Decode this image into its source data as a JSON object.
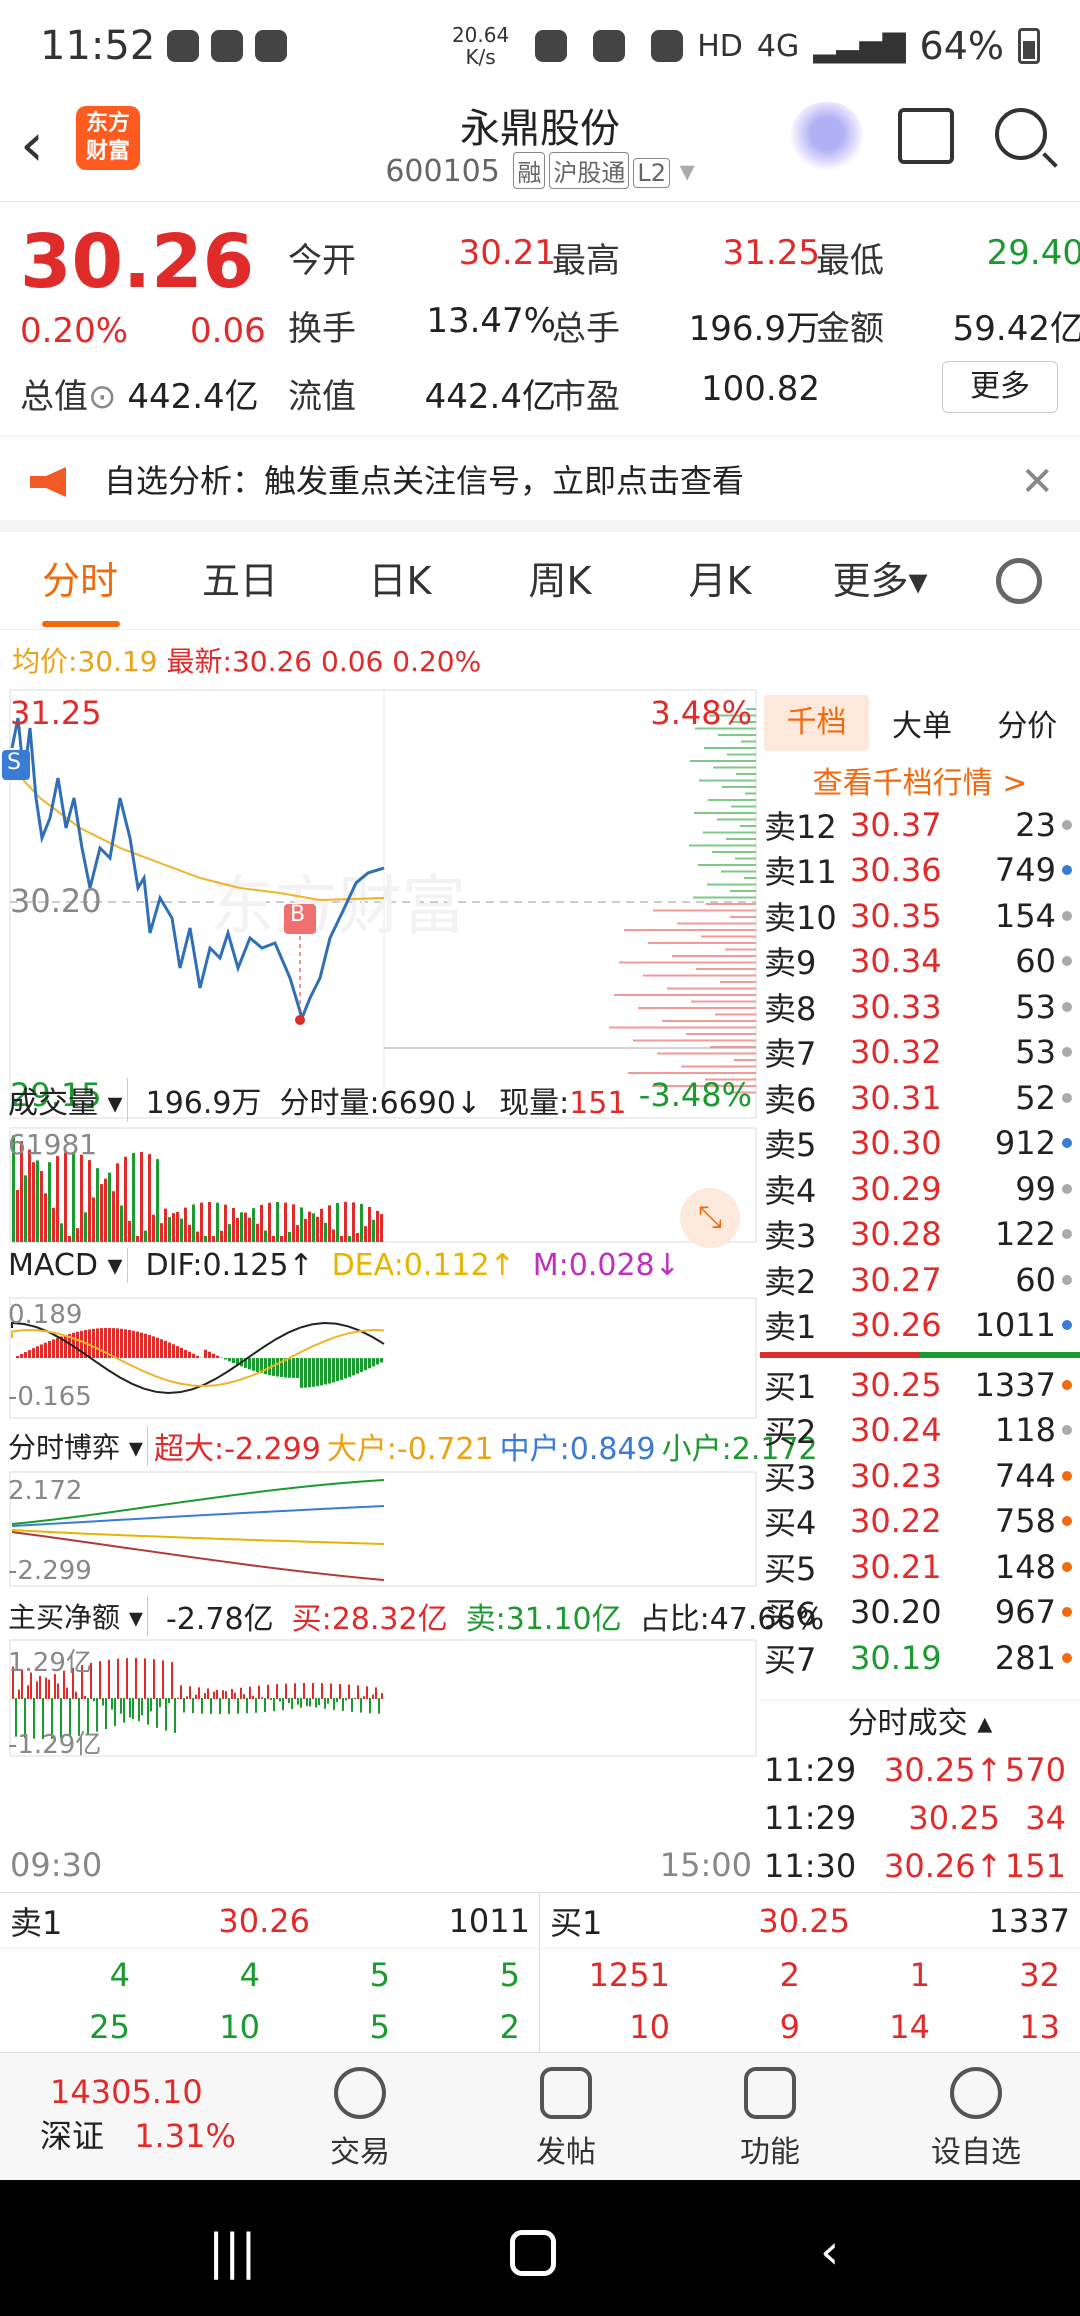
{
  "status": {
    "time": "11:52",
    "speed_value": "20.64",
    "speed_unit": "K/s",
    "network": "4G",
    "hd": "HD",
    "battery": "64%"
  },
  "header": {
    "logo_text": "东方财富",
    "title": "永鼎股份",
    "code": "600105",
    "tags": [
      "融",
      "沪股通",
      "L2"
    ]
  },
  "quote": {
    "price": "30.26",
    "pct": "0.20%",
    "change": "0.06",
    "fields": [
      {
        "label": "今开",
        "value": "30.21",
        "color": "#e02b2b"
      },
      {
        "label": "最高",
        "value": "31.25",
        "color": "#e02b2b"
      },
      {
        "label": "最低",
        "value": "29.40",
        "color": "#1b9a2f"
      },
      {
        "label": "换手",
        "value": "13.47%",
        "color": "#222"
      },
      {
        "label": "总手",
        "value": "196.9万",
        "color": "#222"
      },
      {
        "label": "金额",
        "value": "59.42亿",
        "color": "#222"
      },
      {
        "label": "流值",
        "value": "442.4亿",
        "color": "#222"
      },
      {
        "label": "市盈",
        "value": "100.82",
        "color": "#222"
      }
    ],
    "zongzhi_label": "总值",
    "zongzhi_value": "442.4亿",
    "more_label": "更多"
  },
  "alert": {
    "text": "自选分析：触发重点关注信号，立即点击查看"
  },
  "tabs": [
    "分时",
    "五日",
    "日K",
    "周K",
    "月K",
    "更多▾"
  ],
  "avg_row": {
    "avg_label": "均价:",
    "avg": "30.19",
    "new_label": "最新:",
    "new": "30.26",
    "chg": "0.06",
    "pct": "0.20%"
  },
  "intraday": {
    "high": "31.25",
    "low": "29.15",
    "mid": "30.20",
    "pct_up": "3.48%",
    "pct_down": "-3.48%",
    "watermark": "东方财富",
    "marker": "B",
    "badge": "S"
  },
  "volume_row": {
    "label": "成交量",
    "total": "196.9万",
    "fs_label": "分时量:",
    "fs": "6690↓",
    "now_label": "现量:",
    "now": "151",
    "max": "61981"
  },
  "macd_row": {
    "label": "MACD",
    "dif": "DIF:0.125↑",
    "dea": "DEA:0.112↑",
    "m": "M:0.028↓",
    "top": "0.189",
    "bottom": "-0.165"
  },
  "game_row": {
    "label": "分时博弈",
    "cd": "超大:-2.299",
    "d": "大户:-0.721",
    "z": "中户:0.849",
    "x": "小户:2.172",
    "top": "2.172",
    "bottom": "-2.299"
  },
  "flow_row": {
    "label": "主买净额",
    "net": "-2.78亿",
    "buy": "买:28.32亿",
    "sell": "卖:31.10亿",
    "ratio": "占比:47.66%",
    "top": "1.29亿",
    "bottom": "-1.29亿"
  },
  "time_axis": {
    "start": "09:30",
    "end": "15:00"
  },
  "book": {
    "tabs": [
      "千档",
      "大单",
      "分价"
    ],
    "link": "查看千档行情 >",
    "asks": [
      {
        "n": "卖12",
        "p": "30.37",
        "v": "23",
        "w": 0.02,
        "c": "#aaa"
      },
      {
        "n": "卖11",
        "p": "30.36",
        "v": "749",
        "w": 0.4,
        "c": "#3a7bd5"
      },
      {
        "n": "卖10",
        "p": "30.35",
        "v": "154",
        "w": 0.08,
        "c": "#aaa"
      },
      {
        "n": "卖9",
        "p": "30.34",
        "v": "60",
        "w": 0.04,
        "c": "#aaa"
      },
      {
        "n": "卖8",
        "p": "30.33",
        "v": "53",
        "w": 0.03,
        "c": "#aaa"
      },
      {
        "n": "卖7",
        "p": "30.32",
        "v": "53",
        "w": 0.03,
        "c": "#aaa"
      },
      {
        "n": "卖6",
        "p": "30.31",
        "v": "52",
        "w": 0.03,
        "c": "#aaa"
      },
      {
        "n": "卖5",
        "p": "30.30",
        "v": "912",
        "w": 0.5,
        "c": "#3a7bd5"
      },
      {
        "n": "卖4",
        "p": "30.29",
        "v": "99",
        "w": 0.05,
        "c": "#aaa"
      },
      {
        "n": "卖3",
        "p": "30.28",
        "v": "122",
        "w": 0.06,
        "c": "#aaa"
      },
      {
        "n": "卖2",
        "p": "30.27",
        "v": "60",
        "w": 0.04,
        "c": "#aaa"
      },
      {
        "n": "卖1",
        "p": "30.26",
        "v": "1011",
        "w": 0.55,
        "c": "#3a7bd5"
      }
    ],
    "bids": [
      {
        "n": "买1",
        "p": "30.25",
        "v": "1337",
        "w": 0.73,
        "c": "#f06a0e",
        "pc": "#e02b2b"
      },
      {
        "n": "买2",
        "p": "30.24",
        "v": "118",
        "w": 0.06,
        "c": "#aaa",
        "pc": "#e02b2b"
      },
      {
        "n": "买3",
        "p": "30.23",
        "v": "744",
        "w": 0.4,
        "c": "#f06a0e",
        "pc": "#e02b2b"
      },
      {
        "n": "买4",
        "p": "30.22",
        "v": "758",
        "w": 0.41,
        "c": "#f06a0e",
        "pc": "#e02b2b"
      },
      {
        "n": "买5",
        "p": "30.21",
        "v": "148",
        "w": 0.08,
        "c": "#f06a0e",
        "pc": "#e02b2b"
      },
      {
        "n": "买6",
        "p": "30.20",
        "v": "967",
        "w": 0.52,
        "c": "#f06a0e",
        "pc": "#222"
      },
      {
        "n": "买7",
        "p": "30.19",
        "v": "281",
        "w": 0.15,
        "c": "#f06a0e",
        "pc": "#1b9a2f"
      }
    ],
    "ticks_title": "分时成交",
    "ticks": [
      {
        "t": "11:29",
        "p": "30.25↑",
        "v": "570"
      },
      {
        "t": "11:29",
        "p": "30.25",
        "v": "34"
      },
      {
        "t": "11:30",
        "p": "30.26↑",
        "v": "151"
      }
    ]
  },
  "bottom_quote": {
    "left": {
      "label": "卖1",
      "price": "30.26",
      "vol": "1011",
      "row1": [
        "4",
        "4",
        "5",
        "5"
      ],
      "row2": [
        "25",
        "10",
        "5",
        "2"
      ]
    },
    "right": {
      "label": "买1",
      "price": "30.25",
      "vol": "1337",
      "row1": [
        "1251",
        "2",
        "1",
        "32"
      ],
      "row2": [
        "10",
        "9",
        "14",
        "13"
      ]
    }
  },
  "nav": {
    "index_value": "14305.10",
    "index_name": "深证",
    "index_pct": "1.31%",
    "items": [
      "交易",
      "发帖",
      "功能",
      "设自选"
    ]
  }
}
